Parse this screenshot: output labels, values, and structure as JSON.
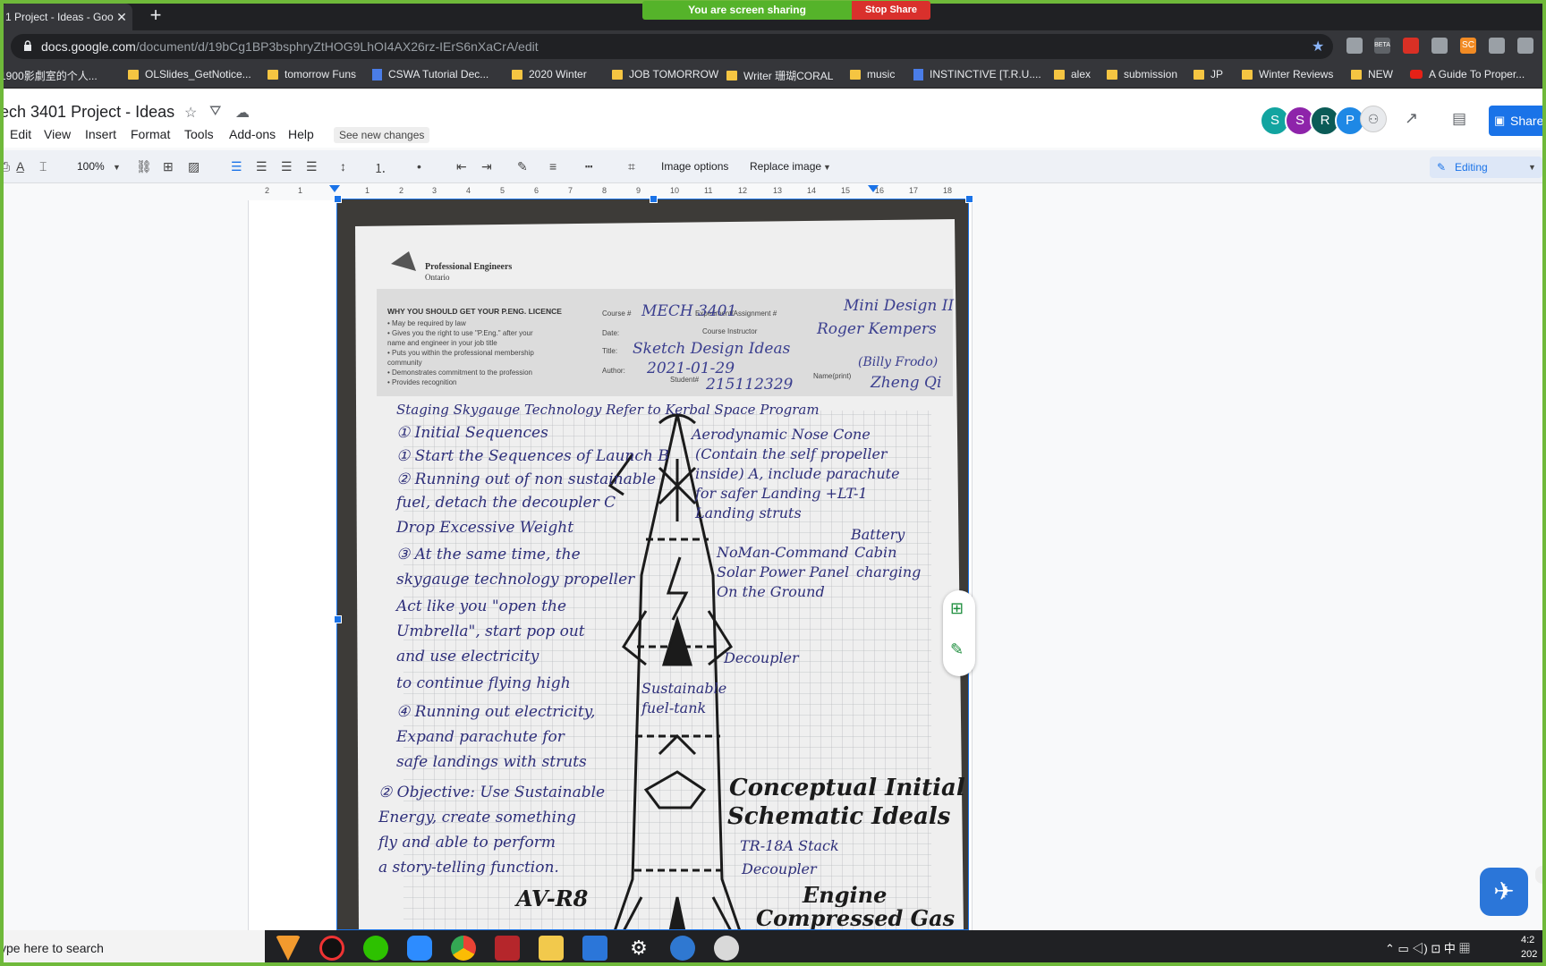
{
  "browser": {
    "tab_title": "1 Project - Ideas - Goo",
    "tab_close": "✕",
    "new_tab": "+",
    "url_host": "docs.google.com",
    "url_path": "/document/d/19bCg1BP3bsphryZtHOG9LhOI4AX26rz-IErS6nXaCrA/edit",
    "extensions": [
      {
        "icon": "extension-gray-icon",
        "color": "#9aa0a6",
        "label": ""
      },
      {
        "icon": "beta-extension-icon",
        "color": "#5f6368",
        "label": "BETA"
      },
      {
        "icon": "acrobat-icon",
        "color": "#d93025",
        "label": ""
      },
      {
        "icon": "k-extension-icon",
        "color": "#9aa0a6",
        "label": ""
      },
      {
        "icon": "sc-extension-icon",
        "color": "#f28b24",
        "label": "SC"
      },
      {
        "icon": "check-extension-icon",
        "color": "#9aa0a6",
        "label": ""
      },
      {
        "icon": "puzzle-icon",
        "color": "#9aa0a6",
        "label": ""
      }
    ]
  },
  "screen_share": {
    "indicator": "You are screen sharing",
    "stop": "Stop Share"
  },
  "bookmarks": [
    {
      "label": "1900影劇室的个人...",
      "icon": "folder"
    },
    {
      "label": "OLSlides_GetNotice...",
      "icon": "folder"
    },
    {
      "label": "tomorrow Funs",
      "icon": "folder"
    },
    {
      "label": "CSWA Tutorial Dec...",
      "icon": "doc"
    },
    {
      "label": "2020 Winter",
      "icon": "folder"
    },
    {
      "label": "JOB TOMORROW",
      "icon": "folder"
    },
    {
      "label": "Writer 珊瑚CORAL",
      "icon": "folder"
    },
    {
      "label": "music",
      "icon": "folder"
    },
    {
      "label": "INSTINCTIVE [T.R.U....",
      "icon": "doc"
    },
    {
      "label": "alex",
      "icon": "folder"
    },
    {
      "label": "submission",
      "icon": "folder"
    },
    {
      "label": "JP",
      "icon": "folder"
    },
    {
      "label": "Winter Reviews",
      "icon": "folder"
    },
    {
      "label": "NEW",
      "icon": "folder"
    },
    {
      "label": "A Guide To Proper...",
      "icon": "youtube"
    }
  ],
  "docs": {
    "title": "ech 3401 Project - Ideas",
    "menus": [
      "Edit",
      "View",
      "Insert",
      "Format",
      "Tools",
      "Add-ons",
      "Help"
    ],
    "see_new_changes": "See new changes",
    "avatars": [
      {
        "letter": "S",
        "color": "#12a4a0"
      },
      {
        "letter": "S",
        "color": "#8e24aa"
      },
      {
        "letter": "R",
        "color": "#0b5b57"
      },
      {
        "letter": "P",
        "color": "#1e88e5"
      }
    ],
    "share_label": "Share",
    "zoom": "100%",
    "image_options": "Image options",
    "replace_image": "Replace image",
    "editing_mode": "Editing",
    "ruler_ticks": [
      "2",
      "1",
      "1",
      "2",
      "3",
      "4",
      "5",
      "6",
      "7",
      "8",
      "9",
      "10",
      "11",
      "12",
      "13",
      "14",
      "15",
      "16",
      "17",
      "18"
    ]
  },
  "sketch": {
    "header": {
      "org": "Professional Engineers",
      "org_sub": "Ontario",
      "why_title": "WHY YOU SHOULD GET YOUR P.ENG. LICENCE",
      "bullets": [
        "• May be required by law",
        "• Gives you the right to use \"P.Eng.\" after your",
        "  name and engineer in your job title",
        "• Puts you within the professional membership",
        "  community",
        "• Demonstrates commitment to the profession",
        "• Provides recognition"
      ],
      "course_label": "Course #",
      "course": "MECH 3401",
      "assign_label": "Experiment/Assignment #",
      "assign": "Mini Design II",
      "instructor_label": "Course Instructor",
      "instructor": "Roger Kempers",
      "date_label": "Date:",
      "title_label": "Title:",
      "title": "Sketch Design Ideas",
      "author_label": "Author:",
      "author_date": "2021-01-29",
      "student_label": "Student#",
      "student": "215112329",
      "name_label": "Name(print)",
      "name": "Zheng Qi",
      "nick": "(Billy Frodo)"
    },
    "notes": [
      "Staging      Skygauge Technology  Refer to Kerbal Space Program",
      "① Initial Sequences",
      "① Start the Sequences of Launch B",
      "② Running out of non sustainable",
      "fuel, detach the decoupler C",
      "Drop Excessive Weight",
      "③ At the same time, the",
      "skygauge technology propeller",
      "Act like you \"open the",
      "Umbrella\", start pop out",
      "and use electricity",
      "to continue flying high",
      "④ Running out electricity,",
      "Expand parachute for",
      "safe landings with struts",
      "② Objective: Use Sustainable",
      "Energy, create something",
      "fly and able to perform",
      "a story-telling function."
    ],
    "right_notes": [
      "Aerodynamic Nose Cone",
      "(Contain the self propeller",
      "inside) A, include parachute",
      "for safer Landing +LT-1",
      "Landing struts",
      "NoMan-Command",
      "Solar Power Panel",
      "On the Ground",
      "Battery",
      "Cabin",
      "charging",
      "Decoupler",
      "Sustainable",
      "fuel-tank",
      "Conceptual Initial",
      "Schematic Ideals",
      "TR-18A Stack",
      "Decoupler",
      "Engine",
      "Compressed Gas",
      "AV-R8"
    ]
  },
  "taskbar": {
    "search_placeholder": "ype here to search",
    "time": "4:2",
    "date": "202"
  }
}
